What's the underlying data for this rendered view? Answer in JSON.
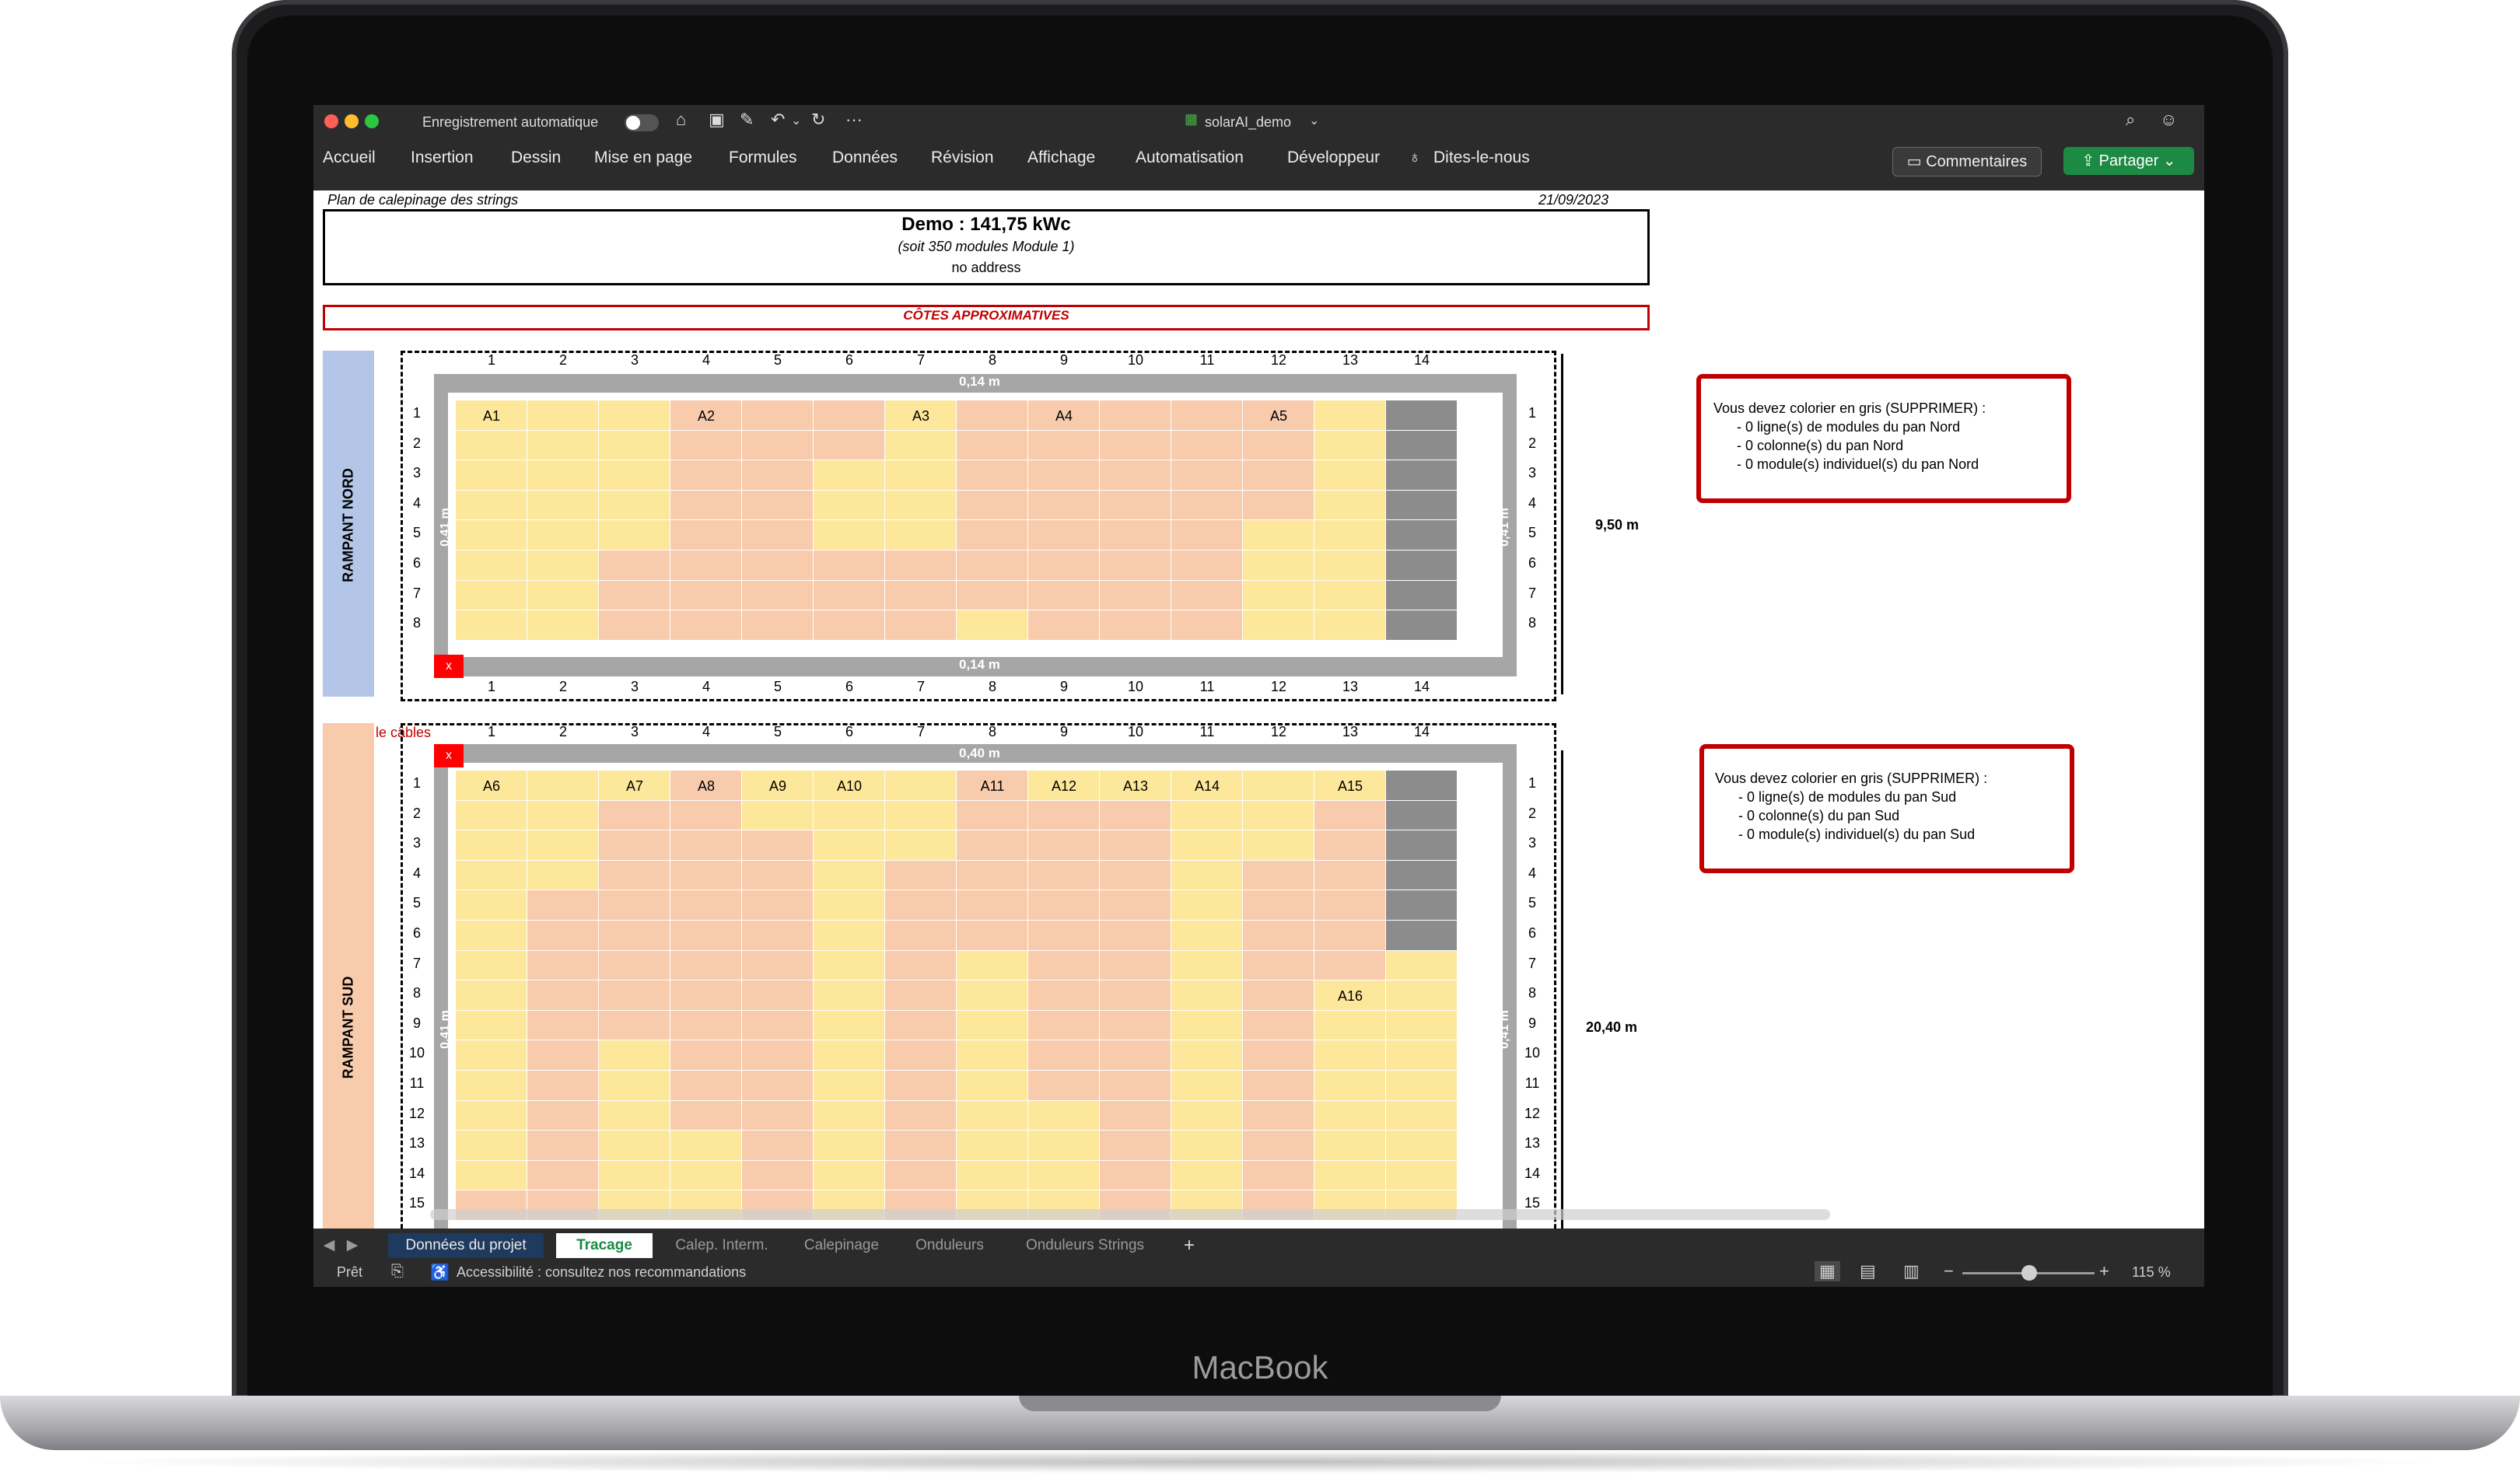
{
  "device": {
    "brand": "MacBook"
  },
  "titlebar": {
    "autosave_label": "Enregistrement automatique",
    "document_title": "solarAI_demo"
  },
  "ribbon": {
    "tabs": [
      "Accueil",
      "Insertion",
      "Dessin",
      "Mise en page",
      "Formules",
      "Données",
      "Révision",
      "Affichage",
      "Automatisation",
      "Développeur"
    ],
    "tell_me": "Dites-le-nous",
    "comments_label": "Commentaires",
    "share_label": "Partager"
  },
  "sheet": {
    "header_left": "Plan de calepinage des strings",
    "header_date": "21/09/2023",
    "project_title": "Demo : 141,75 kWc",
    "project_subtitle": "(soit 350 modules Module 1)",
    "project_address": "no address",
    "approx_banner": "CÔTES APPROXIMATIVES",
    "cables_note": "le câbles",
    "north": {
      "label": "RAMPANT NORD",
      "col_numbers": [
        "1",
        "2",
        "3",
        "4",
        "5",
        "6",
        "7",
        "8",
        "9",
        "10",
        "11",
        "12",
        "13",
        "14"
      ],
      "row_numbers": [
        "1",
        "2",
        "3",
        "4",
        "5",
        "6",
        "7",
        "8"
      ],
      "top_margin": "0,14 m",
      "bottom_margin": "0,14 m",
      "left_margin": "0,41 m",
      "right_margin": "0,41 m",
      "height_dim": "9,50 m",
      "corner_marker": "x",
      "string_labels": [
        {
          "label": "A1",
          "col": 1
        },
        {
          "label": "A2",
          "col": 4
        },
        {
          "label": "A3",
          "col": 7
        },
        {
          "label": "A4",
          "col": 9
        },
        {
          "label": "A5",
          "col": 12
        }
      ],
      "info": [
        "Vous devez colorier en gris (SUPPRIMER) :",
        "- 0 ligne(s) de modules du pan Nord",
        "- 0 colonne(s) du pan Nord",
        "- 0 module(s) individuel(s) du pan Nord"
      ]
    },
    "south": {
      "label": "RAMPANT SUD",
      "col_numbers": [
        "1",
        "2",
        "3",
        "4",
        "5",
        "6",
        "7",
        "8",
        "9",
        "10",
        "11",
        "12",
        "13",
        "14"
      ],
      "row_numbers": [
        "1",
        "2",
        "3",
        "4",
        "5",
        "6",
        "7",
        "8",
        "9",
        "10",
        "11",
        "12",
        "13",
        "14",
        "15"
      ],
      "top_margin": "0,40 m",
      "left_margin": "0,41 m",
      "right_margin": "0,41 m",
      "height_dim": "20,40 m",
      "corner_marker": "x",
      "string_labels": [
        {
          "label": "A6",
          "col": 1
        },
        {
          "label": "A7",
          "col": 3
        },
        {
          "label": "A8",
          "col": 4
        },
        {
          "label": "A9",
          "col": 5
        },
        {
          "label": "A10",
          "col": 6
        },
        {
          "label": "A11",
          "col": 8
        },
        {
          "label": "A12",
          "col": 9
        },
        {
          "label": "A13",
          "col": 10
        },
        {
          "label": "A14",
          "col": 11
        },
        {
          "label": "A15",
          "col": 13
        }
      ],
      "extra_label": {
        "label": "A16",
        "col": 13,
        "row": 8
      },
      "info": [
        "Vous devez colorier en gris (SUPPRIMER) :",
        "- 0 ligne(s) de modules du pan Sud",
        "- 0 colonne(s) du pan Sud",
        "- 0 module(s) individuel(s) du pan Sud"
      ]
    }
  },
  "sheet_tabs": [
    "Données du projet",
    "Tracage",
    "Calep. Interm.",
    "Calepinage",
    "Onduleurs",
    "Onduleurs Strings"
  ],
  "status": {
    "ready": "Prêt",
    "accessibility": "Accessibilité : consultez nos recommandations",
    "zoom": "115 %"
  },
  "colors": {
    "yellow": "#fde79b",
    "salmon": "#f8cbad",
    "gray": "#8c8c8c",
    "red": "#c00000",
    "nord": "#b4c6e7",
    "sud": "#f8cbad"
  }
}
